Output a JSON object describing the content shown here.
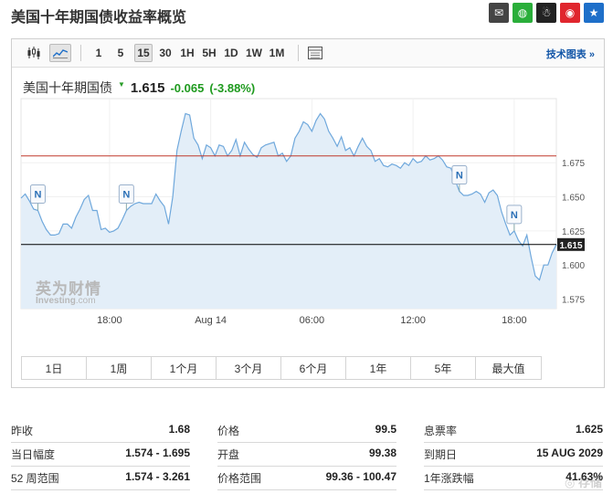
{
  "page": {
    "title": "美国十年期国债收益率概览"
  },
  "share": [
    {
      "name": "email-share-icon",
      "glyph": "✉",
      "color": "#444444"
    },
    {
      "name": "wechat-share-icon",
      "glyph": "◍",
      "color": "#2aae3a"
    },
    {
      "name": "qq-share-icon",
      "glyph": "☃",
      "color": "#222222"
    },
    {
      "name": "weibo-share-icon",
      "glyph": "◉",
      "color": "#e0262e"
    },
    {
      "name": "favorite-share-icon",
      "glyph": "★",
      "color": "#1e6fc9"
    }
  ],
  "toolbar": {
    "intervals": [
      "1",
      "5",
      "15",
      "30",
      "1H",
      "5H",
      "1D",
      "1W",
      "1M"
    ],
    "active_interval": "15",
    "tech_chart_link": "技术图表 »"
  },
  "quote": {
    "name": "美国十年期国债",
    "price": "1.615",
    "change": "-0.065",
    "change_pct": "(-3.88%)"
  },
  "chart_data": {
    "type": "area",
    "ylim": [
      1.568,
      1.722
    ],
    "y_ticks": [
      {
        "value": 1.675,
        "label": "1.675"
      },
      {
        "value": 1.65,
        "label": "1.650"
      },
      {
        "value": 1.625,
        "label": "1.625"
      },
      {
        "value": 1.6,
        "label": "1.600"
      },
      {
        "value": 1.575,
        "label": "1.575"
      }
    ],
    "x_ticks": [
      {
        "index": 21,
        "label": "18:00"
      },
      {
        "index": 45,
        "label": "Aug 14"
      },
      {
        "index": 69,
        "label": "06:00"
      },
      {
        "index": 93,
        "label": "12:00"
      },
      {
        "index": 117,
        "label": "18:00"
      }
    ],
    "reference_lines": [
      {
        "value": 1.68,
        "color": "#c0392b"
      },
      {
        "value": 1.615,
        "color": "#000000"
      }
    ],
    "last_value_label": "1.615",
    "news_markers": [
      {
        "index": 4,
        "label": "N"
      },
      {
        "index": 25,
        "label": "N"
      },
      {
        "index": 104,
        "label": "N"
      },
      {
        "index": 117,
        "label": "N"
      }
    ],
    "values": [
      1.649,
      1.652,
      1.647,
      1.641,
      1.64,
      1.632,
      1.626,
      1.622,
      1.622,
      1.623,
      1.63,
      1.63,
      1.627,
      1.635,
      1.641,
      1.648,
      1.651,
      1.64,
      1.64,
      1.626,
      1.627,
      1.624,
      1.625,
      1.627,
      1.633,
      1.64,
      1.643,
      1.645,
      1.646,
      1.645,
      1.645,
      1.645,
      1.652,
      1.647,
      1.643,
      1.63,
      1.65,
      1.684,
      1.698,
      1.711,
      1.71,
      1.693,
      1.688,
      1.678,
      1.688,
      1.686,
      1.68,
      1.688,
      1.687,
      1.68,
      1.684,
      1.692,
      1.68,
      1.69,
      1.685,
      1.681,
      1.679,
      1.686,
      1.688,
      1.689,
      1.69,
      1.68,
      1.682,
      1.676,
      1.68,
      1.693,
      1.698,
      1.705,
      1.703,
      1.698,
      1.706,
      1.711,
      1.707,
      1.698,
      1.693,
      1.687,
      1.694,
      1.684,
      1.686,
      1.68,
      1.687,
      1.693,
      1.687,
      1.684,
      1.676,
      1.678,
      1.673,
      1.672,
      1.674,
      1.673,
      1.671,
      1.675,
      1.673,
      1.678,
      1.675,
      1.676,
      1.68,
      1.677,
      1.678,
      1.68,
      1.677,
      1.672,
      1.671,
      1.662,
      1.654,
      1.651,
      1.651,
      1.652,
      1.654,
      1.652,
      1.646,
      1.653,
      1.655,
      1.651,
      1.639,
      1.63,
      1.622,
      1.625,
      1.618,
      1.614,
      1.622,
      1.606,
      1.592,
      1.589,
      1.6,
      1.6,
      1.609,
      1.615
    ]
  },
  "ranges": [
    "1日",
    "1周",
    "1个月",
    "3个月",
    "6个月",
    "1年",
    "5年",
    "最大值"
  ],
  "stats": [
    [
      {
        "label": "昨收",
        "value": "1.68"
      },
      {
        "label": "当日幅度",
        "value": "1.574 - 1.695"
      },
      {
        "label": "52 周范围",
        "value": "1.574 - 3.261"
      }
    ],
    [
      {
        "label": "价格",
        "value": "99.5"
      },
      {
        "label": "开盘",
        "value": "99.38"
      },
      {
        "label": "价格范围",
        "value": "99.36 - 100.47"
      }
    ],
    [
      {
        "label": "息票率",
        "value": "1.625"
      },
      {
        "label": "到期日",
        "value": "15 AUG 2029"
      },
      {
        "label": "1年涨跌幅",
        "value": "41.63%"
      }
    ]
  ],
  "colors": {
    "line": "#6fa8dc",
    "fill": "#e3eef8",
    "accent_link": "#1256a8",
    "positive": "#1e9a1e"
  }
}
